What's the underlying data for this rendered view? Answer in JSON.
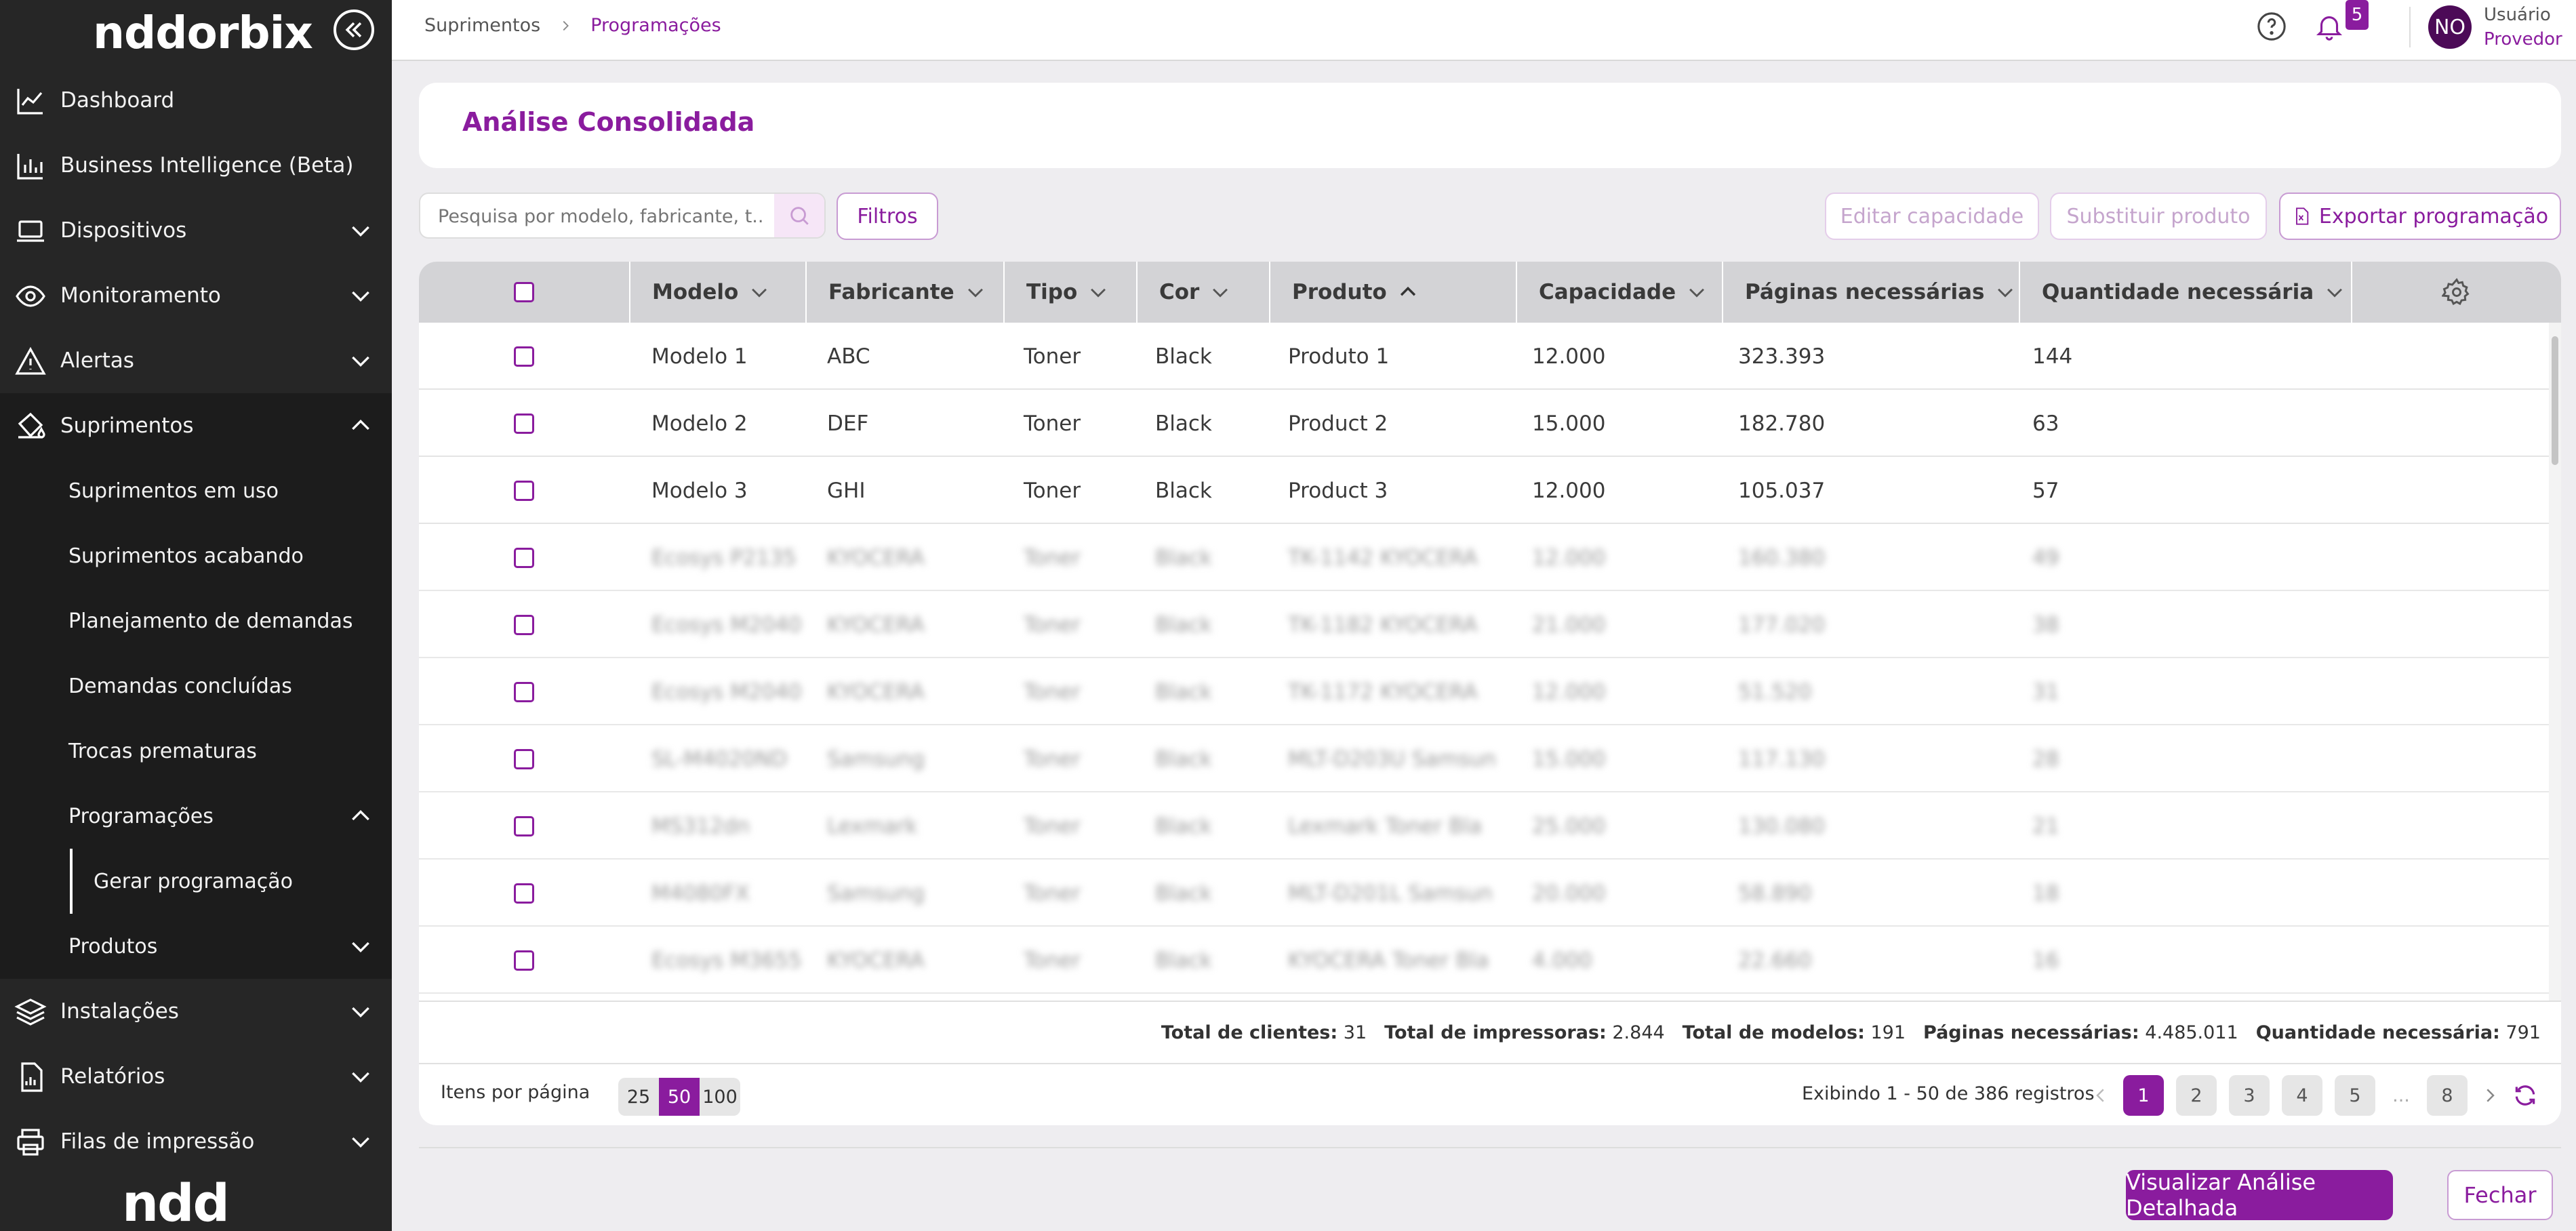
{
  "app": {
    "logo": "nddorbix",
    "brand": "ndd"
  },
  "sidebar": {
    "items": [
      {
        "label": "Dashboard",
        "icon": "chart-line-icon"
      },
      {
        "label": "Business Intelligence (Beta)",
        "icon": "bar-chart-icon"
      },
      {
        "label": "Dispositivos",
        "icon": "laptop-icon"
      },
      {
        "label": "Monitoramento",
        "icon": "eye-icon"
      },
      {
        "label": "Alertas",
        "icon": "warning-icon"
      },
      {
        "label": "Suprimentos",
        "icon": "paint-bucket-icon"
      }
    ],
    "supplies_sub": [
      "Suprimentos em uso",
      "Suprimentos acabando",
      "Planejamento de demandas",
      "Demandas concluídas",
      "Trocas prematuras",
      "Programações"
    ],
    "schedule_sub": [
      "Gerar programação"
    ],
    "products": "Produtos",
    "bottom_items": [
      {
        "label": "Instalações",
        "icon": "layers-icon"
      },
      {
        "label": "Relatórios",
        "icon": "report-icon"
      },
      {
        "label": "Filas de impressão",
        "icon": "printer-icon"
      }
    ]
  },
  "header": {
    "breadcrumb": [
      "Suprimentos",
      "Programações"
    ],
    "notifications": "5",
    "avatar": "NO",
    "user_name": "Usuário",
    "user_role": "Provedor"
  },
  "page": {
    "title": "Análise Consolidada"
  },
  "toolbar": {
    "search_placeholder": "Pesquisa por modelo, fabricante, t...",
    "filters": "Filtros",
    "edit_capacity": "Editar capacidade",
    "replace_product": "Substituir produto",
    "export": "Exportar programação"
  },
  "table": {
    "columns": [
      "Modelo",
      "Fabricante",
      "Tipo",
      "Cor",
      "Produto",
      "Capacidade",
      "Páginas necessárias",
      "Quantidade necessária"
    ],
    "rows": [
      [
        "Modelo 1",
        "ABC",
        "Toner",
        "Black",
        "Produto 1",
        "12.000",
        "323.393",
        "144"
      ],
      [
        "Modelo 2",
        "DEF",
        "Toner",
        "Black",
        "Product 2",
        "15.000",
        "182.780",
        "63"
      ],
      [
        "Modelo 3",
        "GHI",
        "Toner",
        "Black",
        "Product 3",
        "12.000",
        "105.037",
        "57"
      ],
      [
        "Ecosys P2135",
        "KYOCERA",
        "Toner",
        "Black",
        "TK-1142 KYOCERA",
        "12.000",
        "160.380",
        "49"
      ],
      [
        "Ecosys M2040",
        "KYOCERA",
        "Toner",
        "Black",
        "TK-1182 KYOCERA",
        "21.000",
        "177.020",
        "38"
      ],
      [
        "Ecosys M2040",
        "KYOCERA",
        "Toner",
        "Black",
        "TK-1172 KYOCERA",
        "12.000",
        "51.520",
        "31"
      ],
      [
        "SL-M4020ND",
        "Samsung",
        "Toner",
        "Black",
        "MLT-D203U Samsun",
        "15.000",
        "117.130",
        "28"
      ],
      [
        "MS312dn",
        "Lexmark",
        "Toner",
        "Black",
        "Lexmark Toner Bla",
        "25.000",
        "130.080",
        "21"
      ],
      [
        "M4080FX",
        "Samsung",
        "Toner",
        "Black",
        "MLT-D201L Samsun",
        "20.000",
        "58.890",
        "18"
      ],
      [
        "Ecosys M3655",
        "KYOCERA",
        "Toner",
        "Black",
        "KYOCERA Toner Bla",
        "4.000",
        "22.660",
        "16"
      ]
    ]
  },
  "totals": [
    {
      "label": "Total de clientes:",
      "value": "31"
    },
    {
      "label": "Total de impressoras:",
      "value": "2.844"
    },
    {
      "label": "Total de modelos:",
      "value": "191"
    },
    {
      "label": "Páginas necessárias:",
      "value": "4.485.011"
    },
    {
      "label": "Quantidade necessária:",
      "value": "791"
    }
  ],
  "pagination": {
    "items_per_page_label": "Itens por página",
    "sizes": [
      "25",
      "50",
      "100"
    ],
    "showing": "Exibindo  1 - 50 de 386 registros",
    "pages": [
      "1",
      "2",
      "3",
      "4",
      "5",
      "...",
      "8"
    ]
  },
  "footer": {
    "detail": "Visualizar Análise Detalhada",
    "close": "Fechar"
  },
  "colors": {
    "accent": "#8a1c9e",
    "sidebar": "#262626"
  }
}
